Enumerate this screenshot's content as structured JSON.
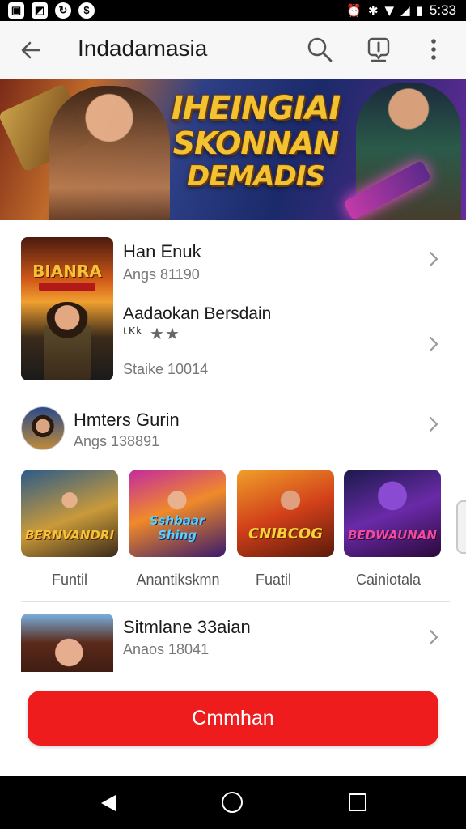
{
  "status_bar": {
    "time": "5:33",
    "left_icons": [
      "image-icon",
      "file-icon",
      "sync-icon",
      "coin-icon"
    ],
    "right_icons": [
      "alarm-icon",
      "bluetooth-icon",
      "wifi-icon",
      "signal-icon",
      "battery-icon"
    ]
  },
  "app_bar": {
    "title": "Indadamasia"
  },
  "banner": {
    "title_line1": "IHEINGIAI",
    "title_line2": "SKONNAN",
    "title_line3": "DEMADIS"
  },
  "featured": {
    "thumb_title": "BIANRA",
    "item1_title": "Han Enuk",
    "item1_sub": "Angs 81190",
    "item2_title": "Aadaokan Bersdain",
    "item2_stars_prefix": "ᵗᴷᵏ",
    "item2_stars": "★★",
    "item2_sub": "Staike 10014"
  },
  "section": {
    "title": "Hmters Gurin",
    "sub": "Angs 138891"
  },
  "games": [
    {
      "name": "Funtil",
      "logo": "BERNVANDRI"
    },
    {
      "name": "Anantikskmn",
      "logo": "Sshbaar Shing"
    },
    {
      "name": "Fuatil",
      "logo": "CNIBCOG"
    },
    {
      "name": "Cainiotala",
      "logo": "BEDWAUNAN"
    }
  ],
  "last_item": {
    "title": "Sitmlane 33aian",
    "sub": "Anaos 18041"
  },
  "cta": {
    "label": "Cmmhan"
  },
  "colors": {
    "accent": "#ee1c1c",
    "appbar_bg": "#f7f7f7",
    "status_bg": "#000000"
  }
}
